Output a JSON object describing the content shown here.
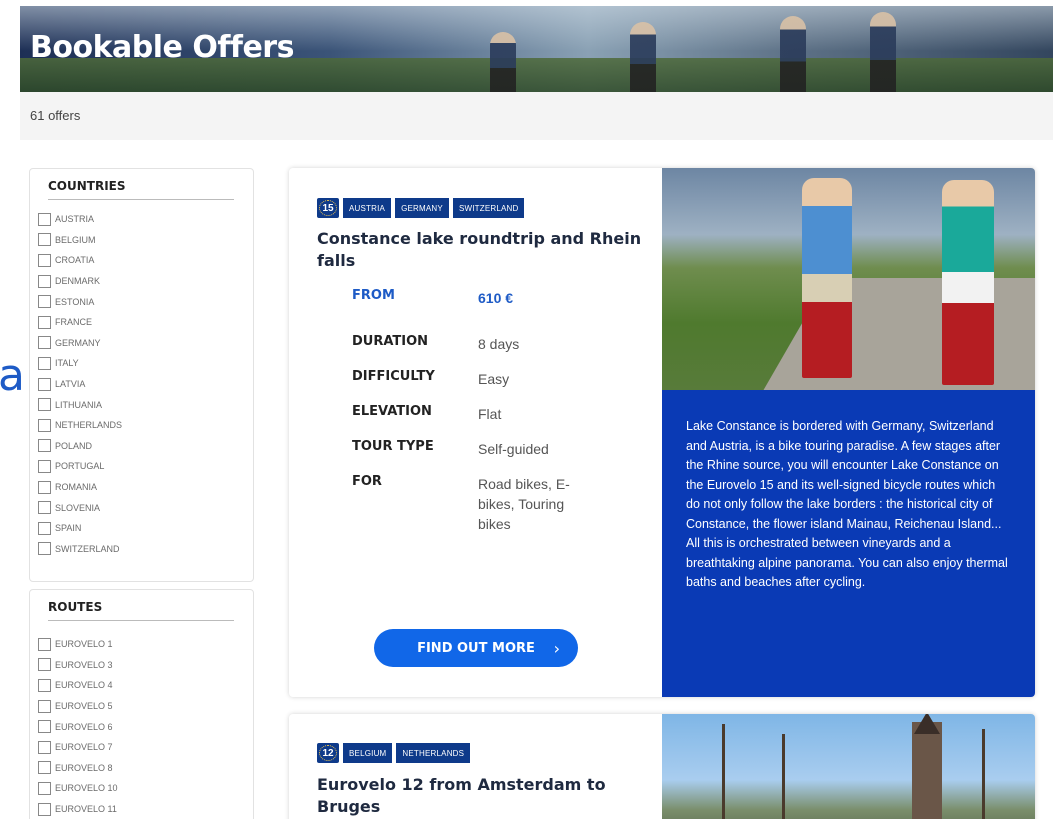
{
  "page": {
    "title": "Bookable Offers",
    "offer_count": "61 offers",
    "edge_glyph": "a"
  },
  "filters": {
    "countries": {
      "title": "COUNTRIES",
      "items": [
        "AUSTRIA",
        "BELGIUM",
        "CROATIA",
        "DENMARK",
        "ESTONIA",
        "FRANCE",
        "GERMANY",
        "ITALY",
        "LATVIA",
        "LITHUANIA",
        "NETHERLANDS",
        "POLAND",
        "PORTUGAL",
        "ROMANIA",
        "SLOVENIA",
        "SPAIN",
        "SWITZERLAND"
      ]
    },
    "routes": {
      "title": "ROUTES",
      "items": [
        "EUROVELO 1",
        "EUROVELO 3",
        "EUROVELO 4",
        "EUROVELO 5",
        "EUROVELO 6",
        "EUROVELO 7",
        "EUROVELO 8",
        "EUROVELO 10",
        "EUROVELO 11"
      ]
    }
  },
  "offers": [
    {
      "eurovelo_number": "15",
      "countries": [
        "AUSTRIA",
        "GERMANY",
        "SWITZERLAND"
      ],
      "title": "Constance lake roundtrip and Rhein falls",
      "specs": [
        {
          "label": "FROM",
          "value": "610 €"
        },
        {
          "label": "DURATION",
          "value": "8 days"
        },
        {
          "label": "DIFFICULTY",
          "value": "Easy"
        },
        {
          "label": "ELEVATION",
          "value": "Flat"
        },
        {
          "label": "TOUR TYPE",
          "value": "Self-guided"
        },
        {
          "label": "FOR",
          "value": "Road bikes, E-bikes, Touring bikes"
        }
      ],
      "cta_label": "FIND OUT MORE",
      "cta_icon": "chevron-right-icon",
      "description": "Lake Constance is bordered with Germany, Switzerland and Austria, is a bike touring paradise. A few stages after the Rhine source, you will encounter Lake Constance on the Eurovelo 15 and its well-signed bicycle routes which do not only follow the lake borders : the historical city of Constance, the flower island Mainau, Reichenau Island... All this is orchestrated between vineyards and a breathtaking alpine panorama. You can also enjoy thermal baths and beaches after cycling."
    },
    {
      "eurovelo_number": "12",
      "countries": [
        "BELGIUM",
        "NETHERLANDS"
      ],
      "title": "Eurovelo 12 from Amsterdam to Bruges"
    }
  ],
  "colors": {
    "brand_blue": "#0a3ab5",
    "badge_blue": "#0e3a8a",
    "cta_blue": "#1167e8",
    "price_blue": "#1e5bc6"
  }
}
